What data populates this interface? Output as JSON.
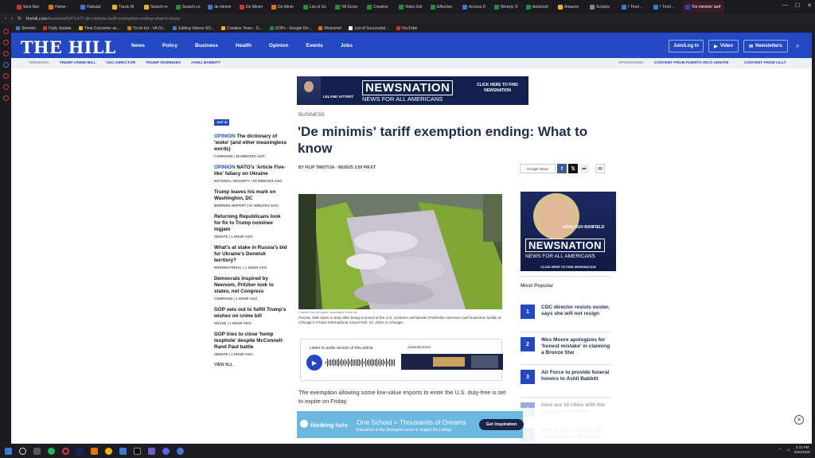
{
  "browser": {
    "tabs": [
      {
        "label": "Sent Mai",
        "color": "#d93025"
      },
      {
        "label": "Home -",
        "color": "#e37400"
      },
      {
        "label": "Hubstaf",
        "color": "#3c78d8"
      },
      {
        "label": "Travis M",
        "color": "#f4b400"
      },
      {
        "label": "Search re",
        "color": "#f4b400"
      },
      {
        "label": "Search co",
        "color": "#1e8e3e"
      },
      {
        "label": "de minimi",
        "color": "#3c78d8"
      },
      {
        "label": "De Minim",
        "color": "#d93025"
      },
      {
        "label": "De Minin",
        "color": "#e37400"
      },
      {
        "label": "List of Su",
        "color": "#1e8e3e"
      },
      {
        "label": "VA Score",
        "color": "#1e8e3e"
      },
      {
        "label": "Creative",
        "color": "#1e8e3e"
      },
      {
        "label": "Video Edi",
        "color": "#1e8e3e"
      },
      {
        "label": "Effective",
        "color": "#1e8e3e"
      },
      {
        "label": "Access D",
        "color": "#3c78d8"
      },
      {
        "label": "Weekly O",
        "color": "#1e8e3e"
      },
      {
        "label": "Antoinett",
        "color": "#1e8e3e"
      },
      {
        "label": "Amazon",
        "color": "#f4b400"
      },
      {
        "label": "Scriptor",
        "color": "#888888"
      },
      {
        "label": "I Tried ..",
        "color": "#3c78d8"
      },
      {
        "label": "I Tried ..",
        "color": "#3c78d8"
      }
    ],
    "active_tab": "'De minimis' tarif",
    "url_host": "thehill.com",
    "url_path": "/business/5471477-de-minimis-tariff-exemption-ending-what-to-know",
    "bookmarks": [
      {
        "label": "Sherwin",
        "color": "#3c78d8"
      },
      {
        "label": "Daily Update",
        "color": "#d93025"
      },
      {
        "label": "Time Converter an...",
        "color": "#f4b400"
      },
      {
        "label": "To-do list - VA Or...",
        "color": "#e37400"
      },
      {
        "label": "Editing Videos SO...",
        "color": "#3c78d8"
      },
      {
        "label": "Creative Team - G...",
        "color": "#f4b400"
      },
      {
        "label": "SOPs - Google Dri...",
        "color": "#1e8e3e"
      },
      {
        "label": "Welcome!",
        "color": "#e37400"
      },
      {
        "label": "List of Successful...",
        "color": "#ffffff"
      },
      {
        "label": "YouTube",
        "color": "#d93025"
      }
    ]
  },
  "site": {
    "logo": "THE HILL",
    "nav": [
      "News",
      "Policy",
      "Business",
      "Health",
      "Opinion",
      "Events",
      "Jobs"
    ],
    "join_label": "Join/Log In",
    "video_label": "Video",
    "newsletters_label": "Newsletters",
    "trending_label": "TRENDING:",
    "trending": [
      "TRUMP CRIME BILL",
      "CDC DIRECTOR",
      "TRUMP NOMINEES",
      "ASHLI BABBITT"
    ],
    "sponsored_label": "SPONSORED:",
    "sponsored": [
      "CONTENT FROM PUERTO RICO SENATE",
      "CONTENT FROM LILLY"
    ]
  },
  "ad_top": {
    "person": "LELAND VITTERT",
    "brand": "NEWSNATION",
    "tagline": "NEWS FOR ALL AMERICANS",
    "cta": "CLICK HERE TO FIND NEWSNATION"
  },
  "just_in": {
    "label": "JUST IN",
    "items": [
      {
        "prefix": "OPINION",
        "title": "The dictionary of 'woke' (and other meaningless words)",
        "meta": "CAMPAIGN | 35 MINUTES AGO"
      },
      {
        "prefix": "OPINION",
        "title": "NATO's 'Article Five-like' fallacy on Ukraine",
        "meta": "NATIONAL SECURITY | 50 MINUTES AGO"
      },
      {
        "prefix": "",
        "title": "Trump leaves his mark on Washington, DC",
        "meta": "MORNING REPORT | 57 MINUTES AGO"
      },
      {
        "prefix": "",
        "title": "Returning Republicans look for fix to Trump nominee logjam",
        "meta": "SENATE | 1 HOUR AGO"
      },
      {
        "prefix": "",
        "title": "What's at stake in Russia's bid for Ukraine's Donetsk territory?",
        "meta": "INTERNATIONAL | 1 HOUR AGO"
      },
      {
        "prefix": "",
        "title": "Democrats inspired by Newsom, Pritzker look to states, not Congress",
        "meta": "CAMPAIGN | 1 HOUR AGO"
      },
      {
        "prefix": "",
        "title": "GOP sets out to fulfill Trump's wishes on crime bill",
        "meta": "HOUSE | 1 HOUR AGO"
      },
      {
        "prefix": "",
        "title": "GOP tries to close 'hemp loophole' despite McConnell-Rand Paul battle",
        "meta": "SENATE | 1 HOUR AGO"
      }
    ],
    "view_all": "VIEW ALL"
  },
  "article": {
    "section": "BUSINESS",
    "headline": "'De minimis' tariff exemption ending: What to know",
    "byline": "BY FILIP TIMOTIJA - 08/26/25 3:59 PM ET",
    "google_news": "Google News",
    "photo_credit": "Charles Rex Arbogast, Associated Press file",
    "caption": "Parcels slide down a ramp after being scanned at the U.S. Customs and Border Protection overseas mail inspection facility at Chicago's O'Hare International Airport Feb. 23, 2024, in Chicago.",
    "audio_label": "Listen to audio version of this article",
    "advertisement_label": "Advertisement",
    "body": "The exemption allowing some low-value imports to enter the U.S. duty-free is set to expire on Friday."
  },
  "ad_right": {
    "person": "ASHLEIGH BANFIELD",
    "brand": "NEWSNATION",
    "tagline": "NEWS FOR ALL AMERICANS",
    "cta": "CLICK HERE TO FIND NEWSNATION"
  },
  "most_popular": {
    "title": "Most Popular",
    "items": [
      {
        "n": "1",
        "title": "CDC director resists ouster, says she will not resign"
      },
      {
        "n": "2",
        "title": "Wes Moore apologizes for 'honest mistake' in claiming a Bronze Star"
      },
      {
        "n": "3",
        "title": "Air Force to provide funeral honors to Ashli Babbitt"
      },
      {
        "n": "4",
        "title": "Here are 10 cities with the highest crime rates"
      },
      {
        "n": "5",
        "title": "RFK Jr. says agency will reveal causes of autism"
      }
    ]
  },
  "ad_bottom": {
    "brand": "thinking huts",
    "headline": "One School = Thousands of Dreams",
    "sub": "Education is the Strongest Lever to Impact the Livings",
    "cta": "Get Inspiration"
  },
  "taskbar": {
    "time": "3:31 PM",
    "date": "8/26/2025"
  }
}
